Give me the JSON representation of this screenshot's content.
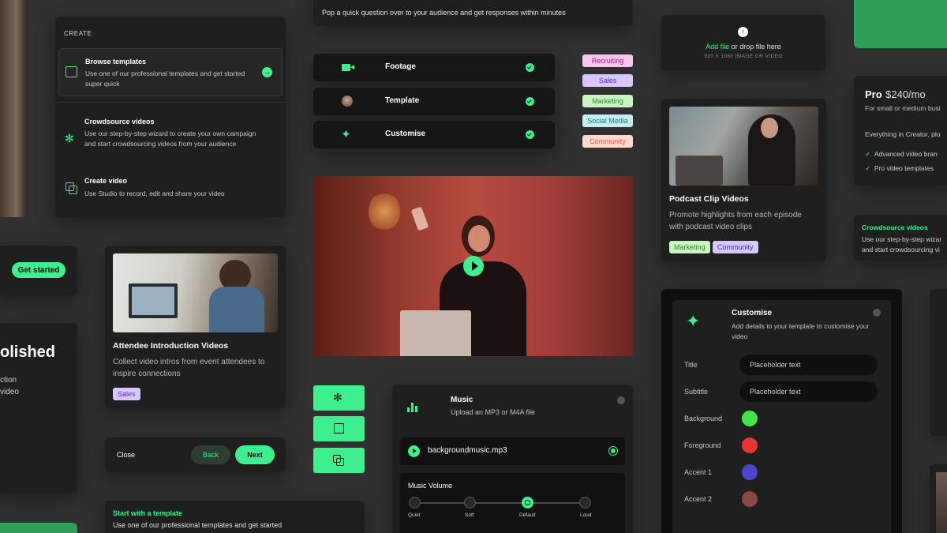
{
  "create_menu": {
    "heading": "CREATE",
    "items": [
      {
        "title": "Browse templates",
        "desc": "Use one of our professional templates and get started super quick"
      },
      {
        "title": "Crowdsource videos",
        "desc": "Use our step-by-step wizard to create your own campaign and start crowdsourcing videos from your audience"
      },
      {
        "title": "Create video",
        "desc": "Use Studio to record, edit and share your video"
      }
    ]
  },
  "quick_question": {
    "text": "Pop a quick question over to your audience and get responses within minutes"
  },
  "steps": [
    {
      "label": "Footage"
    },
    {
      "label": "Template"
    },
    {
      "label": "Customise"
    }
  ],
  "tags": [
    "Recruiting",
    "Sales",
    "Marketing",
    "Social Media",
    "Community"
  ],
  "upload": {
    "link": "Add file",
    "text": " or drop file here",
    "hint": "920 X 1080 IMAGE OR VIDEO"
  },
  "pro": {
    "name": "Pro",
    "price": "$240/mo",
    "desc": "For small or medium busi",
    "includes": "Everything in Creator, plu",
    "features": [
      "Advanced video bran",
      "Pro video templates"
    ]
  },
  "podcast": {
    "title": "Podcast Clip Videos",
    "desc": "Promote highlights from each episode with podcast video clips",
    "tags": [
      "Marketing",
      "Community"
    ]
  },
  "crowdsource_card": {
    "title": "Crowdsource videos",
    "desc": "Use our step-by-step wizar and start crowdsourcing vi"
  },
  "get_started": {
    "label": "Get started"
  },
  "attendee": {
    "title": "Attendee Introduction Videos",
    "desc": "Collect video intros from event attendees to inspire connections",
    "tag": "Sales"
  },
  "published": {
    "title": "olished",
    "line1": "ction",
    "line2": "video"
  },
  "nav": {
    "close": "Close",
    "back": "Back",
    "next": "Next"
  },
  "start_template": {
    "title": "Start with a template",
    "desc": "Use one of our professional templates and get started"
  },
  "music": {
    "title": "Music",
    "subtitle": "Upload an MP3 or M4A file",
    "file": "backgroundmusic.mp3",
    "volume_label": "Music Volume",
    "levels": [
      "Quiet",
      "Soft",
      "Default",
      "Loud"
    ],
    "selected_level": "Default"
  },
  "customise": {
    "title": "Customise",
    "desc": "Add details to your template to customise your video",
    "fields": [
      {
        "label": "Title",
        "placeholder": "Placeholder text"
      },
      {
        "label": "Subtitle",
        "placeholder": "Placeholder text"
      }
    ],
    "colors": [
      {
        "label": "Background",
        "color": "#46e34a"
      },
      {
        "label": "Foreground",
        "color": "#e63535"
      },
      {
        "label": "Accent 1",
        "color": "#4b45c9"
      },
      {
        "label": "Accent 2",
        "color": "#8a4747"
      }
    ]
  },
  "colors": {
    "accent": "#3df08f"
  }
}
